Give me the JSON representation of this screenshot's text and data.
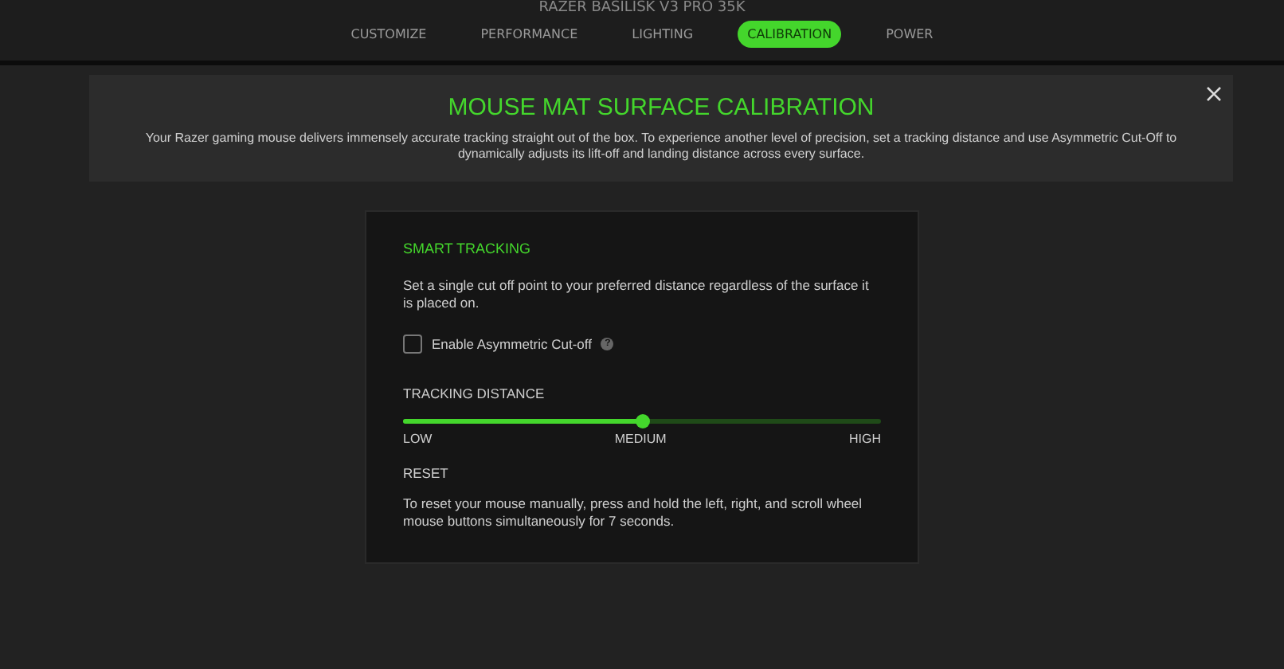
{
  "device_title": "RAZER BASILISK V3 PRO 35K",
  "tabs": [
    {
      "label": "CUSTOMIZE",
      "selected": false
    },
    {
      "label": "PERFORMANCE",
      "selected": false
    },
    {
      "label": "LIGHTING",
      "selected": false
    },
    {
      "label": "CALIBRATION",
      "selected": true
    },
    {
      "label": "POWER",
      "selected": false
    }
  ],
  "banner": {
    "title": "MOUSE MAT SURFACE CALIBRATION",
    "text": "Your Razer gaming mouse delivers immensely accurate tracking straight out of the box. To experience another level of precision, set a tracking distance and use Asymmetric Cut-Off to dynamically adjusts its lift-off and landing distance across every surface."
  },
  "card": {
    "title": "SMART TRACKING",
    "description": "Set a single cut off point to your preferred distance regardless of the surface it is placed on.",
    "checkbox": {
      "label": "Enable Asymmetric Cut-off",
      "checked": false,
      "help": "?"
    },
    "slider": {
      "label": "TRACKING DISTANCE",
      "level": 0.5,
      "ticks": [
        "LOW",
        "MEDIUM",
        "HIGH"
      ]
    },
    "reset": {
      "title": "RESET",
      "text": "To reset your mouse manually, press and hold the left, right, and scroll wheel mouse buttons simultaneously for 7 seconds."
    }
  }
}
